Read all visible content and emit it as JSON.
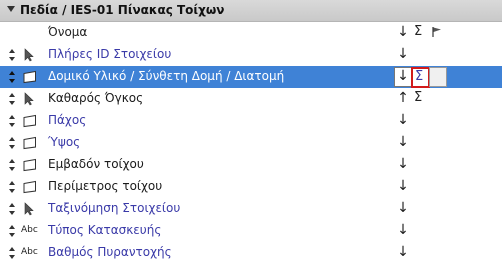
{
  "panel": {
    "title": "Πεδία / IES-01 Πίνακας Τοίχων"
  },
  "columns": {
    "name": "Όνομα",
    "sort_symbol": "↓",
    "sum_symbol": "Σ",
    "flag_icon": "flag-icon"
  },
  "rows": [
    {
      "label": "Πλήρες ID Στοιχείου",
      "icon": "cursor-icon",
      "label_color": "blue",
      "sort": "↓",
      "sum": ""
    },
    {
      "label": "Δομικό Υλικό / Σύνθετη Δομή / Διατομή",
      "icon": "box-icon",
      "label_color": "white",
      "sort": "↓",
      "sum": "Σ",
      "selected": true
    },
    {
      "label": "Καθαρός Όγκος",
      "icon": "cursor-icon",
      "label_color": "black",
      "sort": "↑",
      "sum": "Σ"
    },
    {
      "label": "Πάχος",
      "icon": "box-icon",
      "label_color": "blue",
      "sort": "↓",
      "sum": ""
    },
    {
      "label": "Ύψος",
      "icon": "box-icon",
      "label_color": "blue",
      "sort": "↓",
      "sum": ""
    },
    {
      "label": "Εμβαδόν τοίχου",
      "icon": "box-icon",
      "label_color": "black",
      "sort": "↓",
      "sum": ""
    },
    {
      "label": "Περίμετρος τοίχου",
      "icon": "box-icon",
      "label_color": "black",
      "sort": "↓",
      "sum": ""
    },
    {
      "label": "Ταξινόμηση Στοιχείου",
      "icon": "cursor-icon",
      "label_color": "blue",
      "sort": "↓",
      "sum": ""
    },
    {
      "label": "Τύπος Κατασκευής",
      "icon": "abc-icon",
      "icon_text": "Abc",
      "label_color": "blue",
      "sort": "↓",
      "sum": ""
    },
    {
      "label": "Βαθμός Πυραντοχής",
      "icon": "abc-icon",
      "icon_text": "Abc",
      "label_color": "blue",
      "sort": "↓",
      "sum": ""
    }
  ],
  "colors": {
    "selection": "#3f82d6",
    "link_text": "#3a3aa8",
    "highlight_border": "#d21b1b"
  }
}
